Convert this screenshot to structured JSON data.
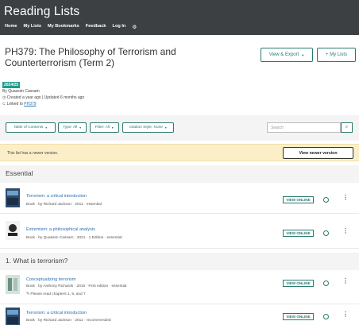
{
  "header": {
    "brand": "Reading Lists",
    "nav": [
      "Home",
      "My Lists",
      "My Bookmarks",
      "Feedback",
      "Log In"
    ],
    "settings_icon": "gear-icon"
  },
  "list": {
    "title": "PH379: The Philosophy of Terrorism and Counterterrorism (Term 2)",
    "year": "2024/25",
    "by": "By Quassim Cassam",
    "created": "Created a year ago | Updated 6 months ago",
    "linked_prefix": "Linked to",
    "linked_code": "PH379",
    "view_export": "View & Export",
    "add_my_lists": "+ My Lists"
  },
  "toolbar": {
    "toc": "Table of Contents",
    "type": "Type: All",
    "filter": "Filter: All",
    "citation": "Citation Style: None",
    "search_placeholder": "Search"
  },
  "notice": {
    "text": "This list has a newer version.",
    "button": "View newer version"
  },
  "sections": [
    {
      "heading": "Essential",
      "items": [
        {
          "title": "Terrorism: a critical introduction",
          "meta": "Book  ·  by Richard Jackson  ·  2011  ·  essential",
          "action": "VIEW ONLINE"
        },
        {
          "title": "Extremism: a philosophical analysis",
          "meta": "Book  ·  by Quassim Cassam  ·  2021  ·  1 Edition  ·  essential",
          "action": "VIEW ONLINE",
          "thumb_text": "Extremism"
        }
      ]
    },
    {
      "heading": "1. What is terrorism?",
      "items": [
        {
          "title": "Conceptualizing terrorism",
          "meta": "Book  ·  by Anthony Richards  ·  2015  ·  First edition  ·  essential",
          "note": "Please read chapters 1, 5, and 7",
          "action": "VIEW ONLINE"
        },
        {
          "title": "Terrorism: a critical introduction",
          "meta": "Book  ·  by Richard Jackson  ·  2011  ·  recommended",
          "action": "VIEW ONLINE"
        }
      ]
    }
  ],
  "colors": {
    "accent": "#2a7a6e",
    "header_bg": "#3d4043",
    "notice_bg": "#fcefc8",
    "badge": "#1f9b8d"
  }
}
